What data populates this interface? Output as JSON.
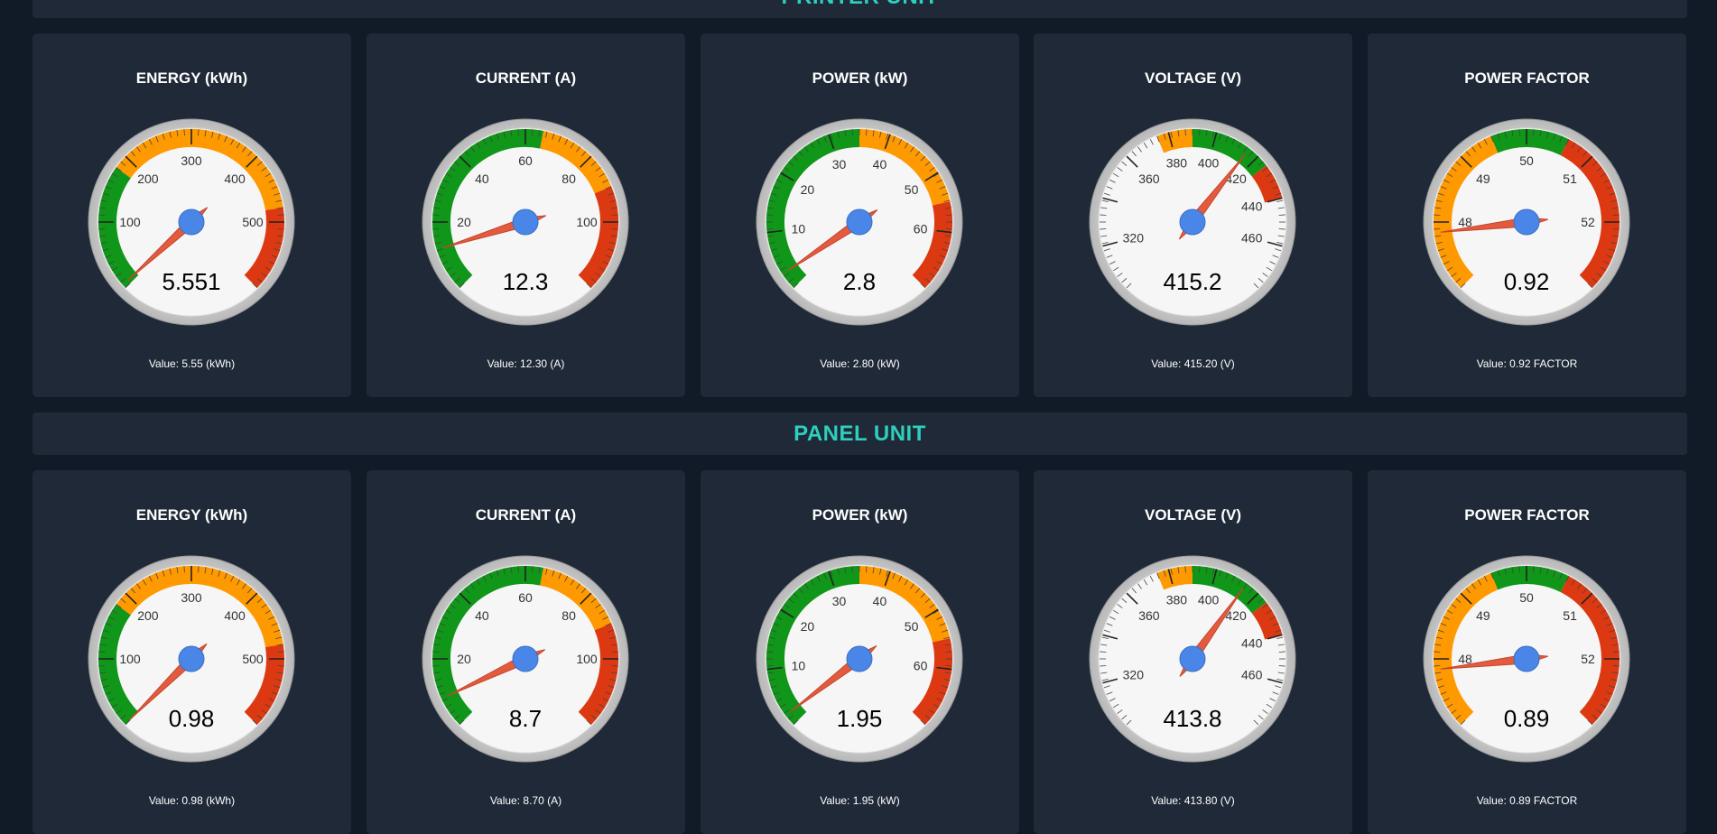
{
  "sections": [
    {
      "title": "PRINTER UNIT",
      "gauges": [
        {
          "label": "ENERGY (kWh)",
          "min": 0,
          "max": 600,
          "value": 5.551,
          "display": "5.551",
          "value_text": "Value: 5.55 (kWh)",
          "ticks": [
            "100",
            "200",
            "300",
            "400",
            "500"
          ],
          "major": [
            100,
            200,
            300,
            400,
            500
          ],
          "bands": [
            {
              "from": 0,
              "to": 180,
              "color": "#109618"
            },
            {
              "from": 180,
              "to": 480,
              "color": "#ff9900"
            },
            {
              "from": 480,
              "to": 600,
              "color": "#dc3912"
            }
          ]
        },
        {
          "label": "CURRENT (A)",
          "min": 0,
          "max": 120,
          "value": 12.3,
          "display": "12.3",
          "value_text": "Value: 12.30 (A)",
          "ticks": [
            "20",
            "40",
            "60",
            "80",
            "100"
          ],
          "major": [
            20,
            40,
            60,
            80,
            100
          ],
          "bands": [
            {
              "from": 0,
              "to": 65,
              "color": "#109618"
            },
            {
              "from": 65,
              "to": 90,
              "color": "#ff9900"
            },
            {
              "from": 90,
              "to": 120,
              "color": "#dc3912"
            }
          ]
        },
        {
          "label": "POWER (kW)",
          "min": 0,
          "max": 70,
          "value": 2.8,
          "display": "2.8",
          "value_text": "Value: 2.80 (kW)",
          "ticks": [
            "10",
            "20",
            "30",
            "40",
            "50",
            "60"
          ],
          "major": [
            10,
            20,
            30,
            40,
            50,
            60
          ],
          "bands": [
            {
              "from": 0,
              "to": 35,
              "color": "#109618"
            },
            {
              "from": 35,
              "to": 55,
              "color": "#ff9900"
            },
            {
              "from": 55,
              "to": 70,
              "color": "#dc3912"
            }
          ]
        },
        {
          "label": "VOLTAGE (V)",
          "min": 300,
          "max": 480,
          "value": 415.2,
          "display": "415.2",
          "value_text": "Value: 415.20 (V)",
          "ticks": [
            "320",
            "360",
            "380",
            "400",
            "420",
            "440",
            "460"
          ],
          "major": [
            320,
            340,
            360,
            380,
            400,
            420,
            440,
            460
          ],
          "bands": [
            {
              "from": 375,
              "to": 390,
              "color": "#ff9900"
            },
            {
              "from": 390,
              "to": 425,
              "color": "#109618"
            },
            {
              "from": 425,
              "to": 440,
              "color": "#dc3912"
            }
          ]
        },
        {
          "label": "POWER FACTOR",
          "min": 47,
          "max": 53,
          "value": 0.92,
          "display": "0.92",
          "value_text": "Value: 0.92 FACTOR",
          "ticks": [
            "48",
            "49",
            "50",
            "51",
            "52"
          ],
          "major": [
            48,
            49,
            50,
            51,
            52
          ],
          "bands": [
            {
              "from": 47,
              "to": 49.5,
              "color": "#ff9900"
            },
            {
              "from": 49.5,
              "to": 50.6,
              "color": "#109618"
            },
            {
              "from": 50.6,
              "to": 53,
              "color": "#dc3912"
            }
          ],
          "needle_pos": 47.85
        }
      ]
    },
    {
      "title": "PANEL UNIT",
      "gauges": [
        {
          "label": "ENERGY (kWh)",
          "min": 0,
          "max": 600,
          "value": 0.98,
          "display": "0.98",
          "value_text": "Value: 0.98 (kWh)",
          "ticks": [
            "100",
            "200",
            "300",
            "400",
            "500"
          ],
          "major": [
            100,
            200,
            300,
            400,
            500
          ],
          "bands": [
            {
              "from": 0,
              "to": 180,
              "color": "#109618"
            },
            {
              "from": 180,
              "to": 480,
              "color": "#ff9900"
            },
            {
              "from": 480,
              "to": 600,
              "color": "#dc3912"
            }
          ]
        },
        {
          "label": "CURRENT (A)",
          "min": 0,
          "max": 120,
          "value": 8.7,
          "display": "8.7",
          "value_text": "Value: 8.70 (A)",
          "ticks": [
            "20",
            "40",
            "60",
            "80",
            "100"
          ],
          "major": [
            20,
            40,
            60,
            80,
            100
          ],
          "bands": [
            {
              "from": 0,
              "to": 65,
              "color": "#109618"
            },
            {
              "from": 65,
              "to": 90,
              "color": "#ff9900"
            },
            {
              "from": 90,
              "to": 120,
              "color": "#dc3912"
            }
          ]
        },
        {
          "label": "POWER (kW)",
          "min": 0,
          "max": 70,
          "value": 1.95,
          "display": "1.95",
          "value_text": "Value: 1.95 (kW)",
          "ticks": [
            "10",
            "20",
            "30",
            "40",
            "50",
            "60"
          ],
          "major": [
            10,
            20,
            30,
            40,
            50,
            60
          ],
          "bands": [
            {
              "from": 0,
              "to": 35,
              "color": "#109618"
            },
            {
              "from": 35,
              "to": 55,
              "color": "#ff9900"
            },
            {
              "from": 55,
              "to": 70,
              "color": "#dc3912"
            }
          ]
        },
        {
          "label": "VOLTAGE (V)",
          "min": 300,
          "max": 480,
          "value": 413.8,
          "display": "413.8",
          "value_text": "Value: 413.80 (V)",
          "ticks": [
            "320",
            "360",
            "380",
            "400",
            "420",
            "440",
            "460"
          ],
          "major": [
            320,
            340,
            360,
            380,
            400,
            420,
            440,
            460
          ],
          "bands": [
            {
              "from": 375,
              "to": 390,
              "color": "#ff9900"
            },
            {
              "from": 390,
              "to": 425,
              "color": "#109618"
            },
            {
              "from": 425,
              "to": 440,
              "color": "#dc3912"
            }
          ]
        },
        {
          "label": "POWER FACTOR",
          "min": 47,
          "max": 53,
          "value": 0.89,
          "display": "0.89",
          "value_text": "Value: 0.89 FACTOR",
          "ticks": [
            "48",
            "49",
            "50",
            "51",
            "52"
          ],
          "major": [
            48,
            49,
            50,
            51,
            52
          ],
          "bands": [
            {
              "from": 47,
              "to": 49.5,
              "color": "#ff9900"
            },
            {
              "from": 49.5,
              "to": 50.6,
              "color": "#109618"
            },
            {
              "from": 50.6,
              "to": 53,
              "color": "#dc3912"
            }
          ],
          "needle_pos": 47.85
        }
      ]
    }
  ],
  "colors": {
    "background": "#111a27",
    "card": "#1f2938",
    "accent": "#2ecfbc",
    "needle": "#e35b3f",
    "hub": "#4a86e8"
  }
}
